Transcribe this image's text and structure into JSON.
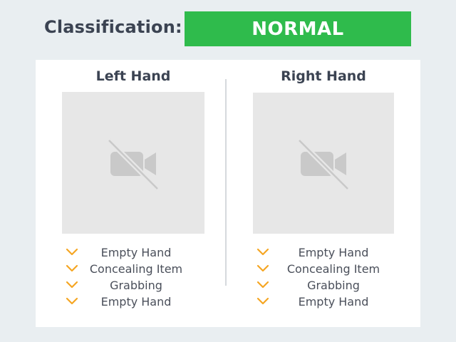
{
  "header": {
    "label": "Classification:",
    "status": "NORMAL",
    "status_color": "#2fbb4c"
  },
  "left_hand": {
    "title": "Left Hand",
    "video_icon": "video-off-icon",
    "events": [
      {
        "label": "Empty Hand",
        "icon": "chevron-down-icon"
      },
      {
        "label": "Concealing Item",
        "icon": "chevron-down-icon"
      },
      {
        "label": "Grabbing",
        "icon": "chevron-down-icon"
      },
      {
        "label": "Empty Hand",
        "icon": "chevron-down-icon"
      }
    ]
  },
  "right_hand": {
    "title": "Right Hand",
    "video_icon": "video-off-icon",
    "events": [
      {
        "label": "Empty Hand",
        "icon": "chevron-down-icon"
      },
      {
        "label": "Concealing Item",
        "icon": "chevron-down-icon"
      },
      {
        "label": "Grabbing",
        "icon": "chevron-down-icon"
      },
      {
        "label": "Empty Hand",
        "icon": "chevron-down-icon"
      }
    ]
  },
  "colors": {
    "accent_chevron": "#f5a623",
    "background": "#e9eef1",
    "placeholder": "#e7e7e7",
    "icon_gray": "#c9c9c9"
  }
}
